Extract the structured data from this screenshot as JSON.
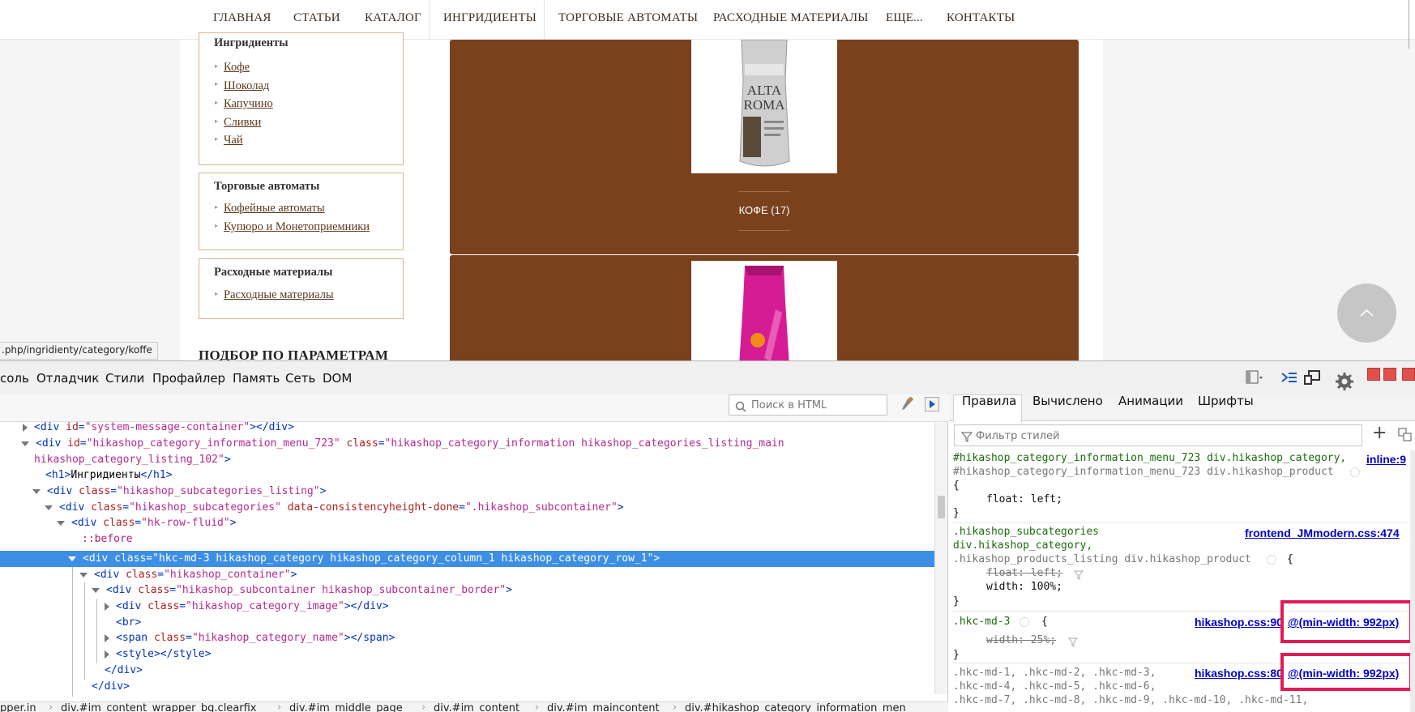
{
  "site": {
    "nav": [
      "ГЛАВНАЯ",
      "СТАТЬИ",
      "КАТАЛОГ",
      "ИНГРИДИЕНТЫ",
      "ТОРГОВЫЕ АВТОМАТЫ",
      "РАСХОДНЫЕ МАТЕРИАЛЫ",
      "ЕЩЕ...",
      "КОНТАКТЫ"
    ],
    "sidebar": {
      "ingredients": {
        "title": "Ингридиенты",
        "links": [
          "Кофе",
          "Шоколад",
          "Капучино",
          "Сливки",
          "Чай"
        ]
      },
      "vending": {
        "title": "Торговые автоматы",
        "links": [
          "Кофейные автоматы",
          "Купюро и Монетоприемники"
        ]
      },
      "supplies": {
        "title": "Расходные материалы",
        "links": [
          "Расходные материалы"
        ]
      }
    },
    "filter_title": "ПОДБОР ПО ПАРАМЕТРАМ",
    "category_label": "КОФЕ (17)",
    "status_url": ".php/ingridienty/category/koffe",
    "brown": "#7a411d"
  },
  "devtools": {
    "tabs": [
      "соль",
      "Отладчик",
      "Стили",
      "Профайлер",
      "Память",
      "Сеть",
      "DOM"
    ],
    "html_search_placeholder": "Поиск в HTML",
    "html_lines": [
      {
        "tag": "div",
        "attrs": [
          [
            "id",
            "system-message-container"
          ]
        ],
        "close": true
      },
      {
        "tag": "div",
        "attrs": [
          [
            "id",
            "hikashop_category_information_menu_723"
          ],
          [
            "class",
            "hikashop_category_information hikashop_categories_listing_main"
          ]
        ]
      },
      {
        "cont": "hikashop_category_listing_102\">"
      },
      {
        "tag": "h1",
        "text": "Ингридиенты"
      },
      {
        "tag": "div",
        "attrs": [
          [
            "class",
            "hikashop_subcategories_listing"
          ]
        ]
      },
      {
        "tag": "div",
        "attrs": [
          [
            "class",
            "hikashop_subcategories"
          ],
          [
            "data-consistencyheight-done",
            ".hikashop_subcontainer"
          ]
        ]
      },
      {
        "tag": "div",
        "attrs": [
          [
            "class",
            "hk-row-fluid"
          ]
        ]
      },
      {
        "pseudo": "::before"
      },
      {
        "tag": "div",
        "attrs": [
          [
            "class",
            "hkc-md-3 hikashop_category hikashop_category_column_1 hikashop_category_row_1"
          ]
        ]
      },
      {
        "tag": "div",
        "attrs": [
          [
            "class",
            "hikashop_container"
          ]
        ]
      },
      {
        "tag": "div",
        "attrs": [
          [
            "class",
            "hikashop_subcontainer hikashop_subcontainer_border"
          ]
        ]
      },
      {
        "tag": "div",
        "attrs": [
          [
            "class",
            "hikashop_category_image"
          ]
        ],
        "close": true
      },
      {
        "tag": "br"
      },
      {
        "tag": "span",
        "attrs": [
          [
            "class",
            "hikashop_category_name"
          ]
        ],
        "close": true
      },
      {
        "tag": "style",
        "close": true
      },
      {
        "closing": "div"
      },
      {
        "closing": "div"
      }
    ],
    "breadcrumb": [
      "pper.in",
      "div.#im_content_wrapper_bg.clearfix",
      "div.#im_middle_page",
      "div.#im_content",
      "div.#im_maincontent",
      "div.#hikashop_category_information_men"
    ],
    "right_tabs": [
      "Правила",
      "Вычислено",
      "Анимации",
      "Шрифты"
    ],
    "style_filter_placeholder": "Фильтр стилей",
    "rules": {
      "r1_sel1": "#hikashop_category_information_menu_723 div.hikashop_category,",
      "r1_sel2": "#hikashop_category_information_menu_723 div.hikashop_product",
      "r1_src": "inline:9",
      "r1_prop": "float: left;",
      "r2_sel1": ".hikashop_subcategories",
      "r2_sel2": "div.hikashop_category,",
      "r2_sel3": ".hikashop_products_listing div.hikashop_product",
      "r2_src": "frontend_JMmodern.css:474",
      "r2_p1": "float: left;",
      "r2_p2": "width: 100%;",
      "r3_sel": ".hkc-md-3",
      "r3_src": "hikashop.css:90",
      "r3_media": "@(min-width: 992px)",
      "r3_prop": "width: 25%;",
      "r4_l1": ".hkc-md-1, .hkc-md-2, .hkc-md-3,",
      "r4_l2": ".hkc-md-4, .hkc-md-5, .hkc-md-6,",
      "r4_l3": ".hkc-md-7, .hkc-md-8, .hkc-md-9, .hkc-md-10, .hkc-md-11,",
      "r4_src": "hikashop.css:80",
      "r4_media": "@(min-width: 992px)"
    },
    "highlight_color": "#e41a58",
    "selection_color": "#3d8fe6"
  }
}
